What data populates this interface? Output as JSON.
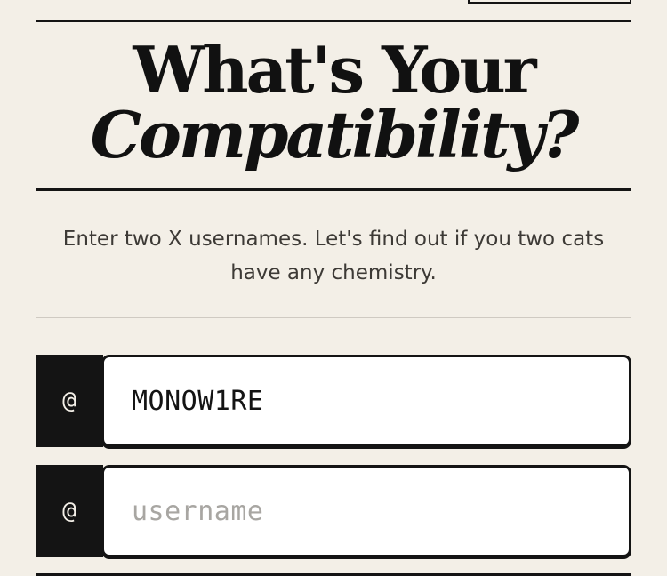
{
  "title": {
    "line1": "What's Your",
    "line2": "Compatibility?"
  },
  "subtitle": {
    "line1": "Enter two X usernames. Let's find out if you two cats",
    "line2": "have any chemistry."
  },
  "form": {
    "prefix": "@",
    "username_1": {
      "value": "MONOW1RE",
      "placeholder": "username"
    },
    "username_2": {
      "value": "",
      "placeholder": "username"
    }
  }
}
